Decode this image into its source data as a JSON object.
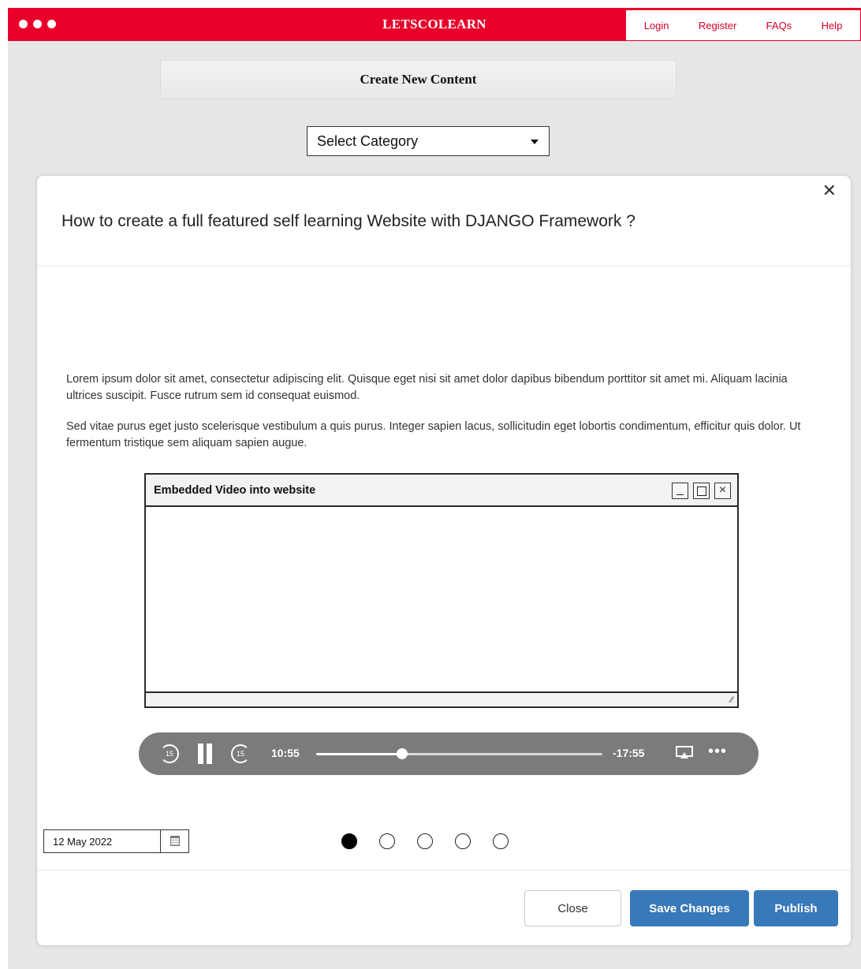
{
  "app": {
    "brand": "LETSCOLEARN",
    "nav": [
      "Login",
      "Register",
      "FAQs",
      "Help"
    ]
  },
  "page": {
    "create_heading": "Create New Content",
    "category_select": {
      "selected": "Select Category"
    }
  },
  "modal": {
    "title": "How to create a full featured self learning Website with DJANGO Framework ?",
    "close_icon": "close-icon",
    "paragraphs": [
      "Lorem ipsum dolor sit amet, consectetur adipiscing elit. Quisque eget nisi sit amet dolor dapibus bibendum porttitor sit amet mi. Aliquam lacinia ultrices suscipit. Fusce rutrum sem id consequat euismod.",
      "Sed vitae purus eget justo scelerisque vestibulum a quis purus. Integer sapien lacus, sollicitudin eget lobortis condimentum, efficitur quis dolor. Ut fermentum tristique sem aliquam sapien augue."
    ],
    "embed": {
      "title": "Embedded Video into website"
    },
    "player": {
      "skip_back_label": "15",
      "skip_forward_label": "15",
      "current_time": "10:55",
      "remaining_time": "-17:55",
      "progress": 0.3
    },
    "date": {
      "value": "12 May 2022"
    },
    "pagination": {
      "count": 5,
      "active_index": 0
    },
    "buttons": {
      "close": "Close",
      "save": "Save Changes",
      "publish": "Publish"
    }
  },
  "colors": {
    "brand_red": "#e8002b",
    "primary_blue": "#3879b9",
    "player_gray": "#7b7b7b",
    "page_gray": "#e6e6e6"
  }
}
